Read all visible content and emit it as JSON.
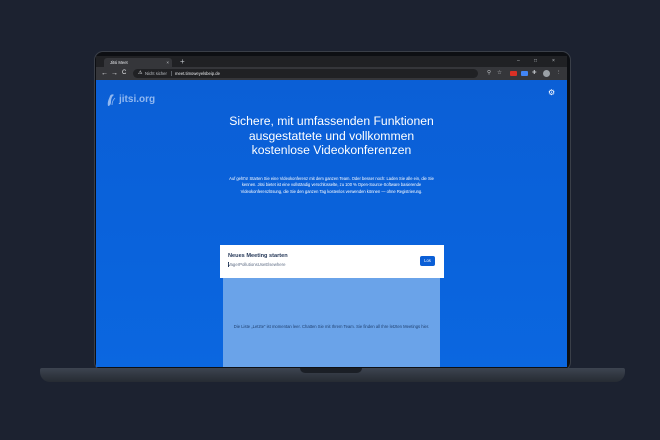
{
  "browser": {
    "tab_title": "Jitsi Meet",
    "tab_close": "×",
    "new_tab": "+",
    "window_controls": [
      "–",
      "□",
      "×"
    ],
    "nav": {
      "back": "←",
      "forward": "→",
      "reload": "C"
    },
    "not_secure": "Nicht sicher",
    "url": "meet.timoweyelsbeip.de"
  },
  "page": {
    "logo_text": "jitsi.org",
    "headline": "Sichere, mit umfassenden Funktionen ausgestattete und vollkommen kostenlose Videokonferenzen",
    "description": "Auf geht's! Starten Sie eine Videokonferenz mit dem ganzen Team. Oder besser noch: Laden Sie alle ein, die Sie kennen. Jitsi bietet ist eine vollständig verschlüsselte, zu 100 % Open-Source-Software basierende Videokonferenzlösung, die Sie den ganzen Tag kostenlos verwenden können — ohne Registrierung.",
    "card": {
      "title": "Neues Meeting starten",
      "input_value": "VagerPollutionsUseElsewhere",
      "go_label": "Los"
    },
    "recent_empty_message": "Die Liste „Letzte“ ist momentan leer. Chatten Sie mit Ihrem Team. Sie finden all Ihre letzten Meetings hier."
  },
  "colors": {
    "page_blue": "#0b5fd6",
    "recent_panel": "#6aa3e9",
    "button_blue": "#0b5fd6"
  }
}
